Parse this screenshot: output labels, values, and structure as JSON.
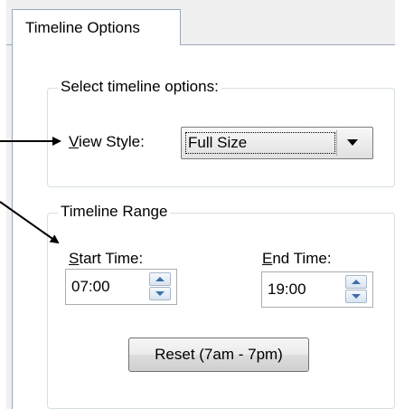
{
  "tabs": [
    {
      "label": "Timeline Options"
    }
  ],
  "options_group": {
    "title": "Select timeline options:",
    "view_style_label": "View Style:",
    "view_style_value": "Full Size"
  },
  "range_group": {
    "title": "Timeline Range",
    "start_label": "Start Time:",
    "start_value": "07:00",
    "end_label": "End Time:",
    "end_value": "19:00",
    "reset_label": "Reset (7am - 7pm)"
  }
}
